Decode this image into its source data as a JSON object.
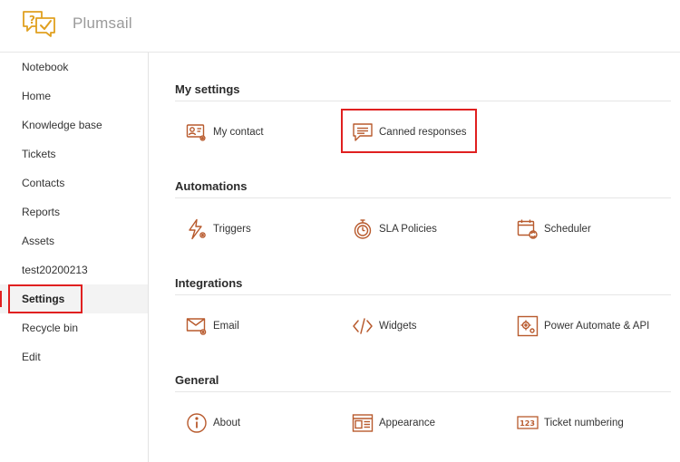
{
  "header": {
    "app_name": "Plumsail"
  },
  "sidebar": {
    "items": [
      {
        "label": "Notebook"
      },
      {
        "label": "Home"
      },
      {
        "label": "Knowledge base"
      },
      {
        "label": "Tickets"
      },
      {
        "label": "Contacts"
      },
      {
        "label": "Reports"
      },
      {
        "label": "Assets"
      },
      {
        "label": "test20200213"
      },
      {
        "label": "Settings",
        "active": true
      },
      {
        "label": "Recycle bin"
      },
      {
        "label": "Edit"
      }
    ]
  },
  "sections": [
    {
      "title": "My settings",
      "items": [
        {
          "label": "My contact",
          "icon": "contact-card-gear-icon"
        },
        {
          "label": "Canned responses",
          "icon": "chat-bubble-lines-icon",
          "highlighted": true
        }
      ]
    },
    {
      "title": "Automations",
      "items": [
        {
          "label": "Triggers",
          "icon": "lightning-gear-icon"
        },
        {
          "label": "SLA Policies",
          "icon": "stopwatch-icon"
        },
        {
          "label": "Scheduler",
          "icon": "calendar-refresh-icon"
        }
      ]
    },
    {
      "title": "Integrations",
      "items": [
        {
          "label": "Email",
          "icon": "envelope-gear-icon"
        },
        {
          "label": "Widgets",
          "icon": "code-brackets-icon"
        },
        {
          "label": "Power Automate & API",
          "icon": "gear-box-icon"
        }
      ]
    },
    {
      "title": "General",
      "items": [
        {
          "label": "About",
          "icon": "info-circle-icon"
        },
        {
          "label": "Appearance",
          "icon": "layout-window-icon"
        },
        {
          "label": "Ticket numbering",
          "icon": "number-123-icon"
        }
      ]
    }
  ],
  "colors": {
    "accent": "#b85a2d",
    "highlight": "#e02020",
    "logo": "#e0a020"
  }
}
